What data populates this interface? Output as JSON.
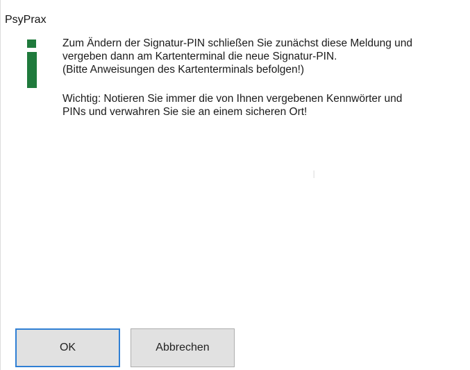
{
  "window": {
    "title": "PsyPrax"
  },
  "icon": "information-icon",
  "message": {
    "line1": "Zum Ändern der Signatur-PIN schließen Sie zunächst diese Meldung und",
    "line2": "vergeben dann am Kartenterminal die neue Signatur-PIN.",
    "line3": "(Bitte Anweisungen des Kartenterminals befolgen!)",
    "line4": "Wichtig: Notieren Sie immer die von Ihnen vergebenen Kennwörter und",
    "line5": "PINs und verwahren Sie sie an einem sicheren Ort!"
  },
  "buttons": {
    "ok_label": "OK",
    "cancel_label": "Abbrechen"
  },
  "colors": {
    "icon_green": "#1f7a3c",
    "focus_border": "#2f7fd4",
    "button_bg": "#e1e1e1"
  }
}
